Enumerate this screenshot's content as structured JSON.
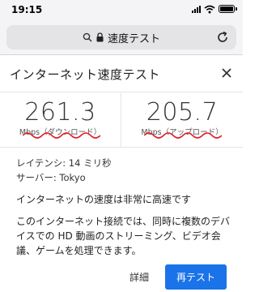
{
  "status": {
    "time": "19:15"
  },
  "browser": {
    "url_text": "速度テスト"
  },
  "page": {
    "title": "インターネット速度テスト"
  },
  "results": {
    "download": {
      "value": "261.3",
      "unit": "Mbps（ダウンロード）"
    },
    "upload": {
      "value": "205.7",
      "unit": "Mbps（アップロード）"
    }
  },
  "details": {
    "latency": "レイテンシ: 14 ミリ秒",
    "server": "サーバー: Tokyo"
  },
  "messages": {
    "summary": "インターネットの速度は非常に高速です",
    "description": "このインターネット接続では、同時に複数のデバイスでの HD 動画のストリーミング、ビデオ会議、ゲームを処理できます。"
  },
  "buttons": {
    "details": "詳細",
    "retest": "再テスト"
  },
  "colors": {
    "accent": "#1a73e8",
    "annotation": "#e0202a"
  }
}
